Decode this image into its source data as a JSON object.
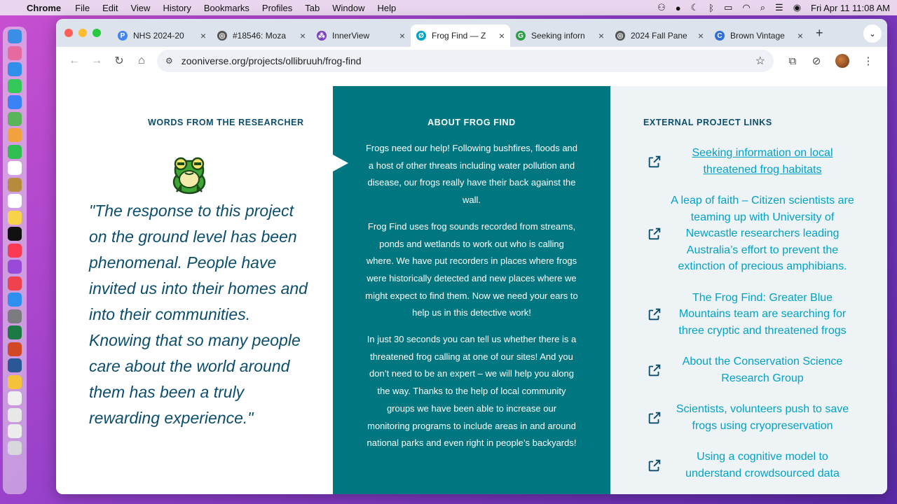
{
  "menubar": {
    "app_name": "Chrome",
    "items": [
      "File",
      "Edit",
      "View",
      "History",
      "Bookmarks",
      "Profiles",
      "Tab",
      "Window",
      "Help"
    ],
    "datetime": "Fri Apr 11  11:08 AM"
  },
  "tabs": [
    {
      "title": "NHS 2024-20",
      "favicon_color": "#4285f4",
      "favicon_glyph": "P"
    },
    {
      "title": "#18546: Moza",
      "favicon_color": "#555555",
      "favicon_glyph": "◎"
    },
    {
      "title": "InnerView",
      "favicon_color": "#7b3fbf",
      "favicon_glyph": "⁂"
    },
    {
      "title": "Frog Find — Z",
      "favicon_color": "#00a2c6",
      "favicon_glyph": "Ø",
      "active": true
    },
    {
      "title": "Seeking inforn",
      "favicon_color": "#2e9e4a",
      "favicon_glyph": "G"
    },
    {
      "title": "2024 Fall Pane",
      "favicon_color": "#555555",
      "favicon_glyph": "◎"
    },
    {
      "title": "Brown Vintage",
      "favicon_color": "#2f6fd6",
      "favicon_glyph": "C"
    }
  ],
  "toolbar": {
    "url": "zooniverse.org/projects/ollibruuh/frog-find"
  },
  "researcher": {
    "heading": "WORDS FROM THE RESEARCHER",
    "quote": "\"The response to this project on the ground level has been phenomenal. People have invited us into their homes and into their communities. Knowing that so many people care about the world around them has been a truly rewarding experience.\""
  },
  "about": {
    "heading": "ABOUT FROG FIND",
    "paragraphs": [
      "Frogs need our help! Following bushfires, floods and a host of other threats including water pollution and disease, our frogs really have their back against the wall.",
      "Frog Find uses frog sounds recorded from streams, ponds and wetlands to work out who is calling where. We have put recorders in places where frogs were historically detected and new places where we might expect to find them. Now we need your ears to help us in this detective work!",
      "In just 30 seconds you can tell us whether there is a threatened frog calling at one of our sites! And you don’t need to be an expert – we will help you along the way. Thanks to the help of local community groups we have been able to increase our monitoring programs to include areas in and around national parks and even right in people’s backyards!"
    ]
  },
  "links": {
    "heading": "EXTERNAL PROJECT LINKS",
    "items": [
      {
        "label": "Seeking information on local threatened frog habitats",
        "underlined": true
      },
      {
        "label": "A leap of faith – Citizen scientists are teaming up with University of Newcastle researchers leading Australia’s effort to prevent the extinction of precious amphibians."
      },
      {
        "label": "The Frog Find: Greater Blue Mountains team are searching for three cryptic and threatened frogs"
      },
      {
        "label": "About the Conservation Science Research Group"
      },
      {
        "label": "Scientists, volunteers push to save frogs using cryopreservation"
      },
      {
        "label": "Using a cognitive model to understand crowdsourced data"
      }
    ]
  },
  "colors": {
    "teal": "#007681",
    "navy": "#0b4d6d",
    "link": "#00a2c6"
  }
}
